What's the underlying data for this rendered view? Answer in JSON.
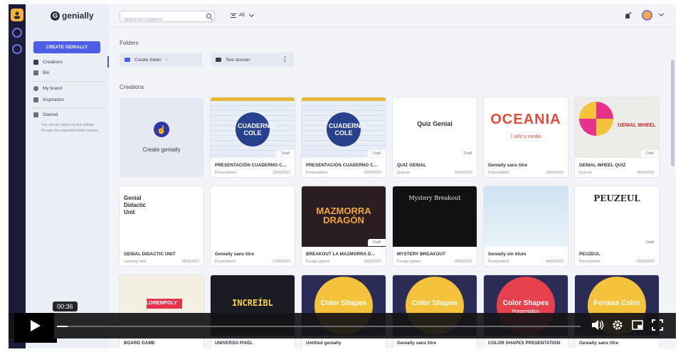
{
  "app": {
    "logo_text": "genially"
  },
  "rail": [
    "avatar-icon",
    "genially-logo-icon",
    "genially-logo-icon"
  ],
  "sidebar": {
    "create_button": "CREATE GENIALLY",
    "items": [
      {
        "label": "Creations",
        "icon": "grid-icon"
      },
      {
        "label": "Bin",
        "icon": "trash-icon"
      },
      {
        "label": "My brand",
        "icon": "brand-icon"
      },
      {
        "label": "Inspiration",
        "icon": "inspiration-icon"
      },
      {
        "label": "Starred",
        "icon": "folder-icon"
      }
    ],
    "starred_note": "You can pin folders to this sidebar through the expanded folder options."
  },
  "topbar": {
    "search_placeholder": "Search for creations",
    "filter_label": "All"
  },
  "folders": {
    "title": "Folders",
    "items": [
      {
        "label": "Create folder"
      },
      {
        "label": "Test dossier"
      }
    ]
  },
  "creations": {
    "title": "Creations",
    "create_label": "Create genially",
    "cards": [
      {
        "title": "PRESENTACIÓN CUADERNO C...",
        "type": "Presentations",
        "date": "19/05/2022",
        "draft": "Draft",
        "thumb_text": "CUADERNO COLE"
      },
      {
        "title": "PRESENTACIÓN CUADERNO C...",
        "type": "Presentations",
        "date": "19/05/2022",
        "draft": "Draft",
        "thumb_text": "CUADERNO COLE"
      },
      {
        "title": "QUIZ GENIAL",
        "type": "Quizzes",
        "date": "19/05/2022",
        "draft": "Draft",
        "thumb_text": "Quiz Genial"
      },
      {
        "title": "Genially sans titre",
        "type": "Personalized",
        "date": "19/05/2022",
        "draft": "",
        "thumb_text": "OCEANIA",
        "thumb_sub": "1 año y medio"
      },
      {
        "title": "GENIAL WHEEL QUIZ",
        "type": "Quizzes",
        "date": "18/05/2022",
        "draft": "Draft",
        "thumb_text": "GENIAL WHEEL"
      },
      {
        "title": "GENIAL DIDACTIC UNIT",
        "type": "Learning units",
        "date": "18/05/2022",
        "draft": "",
        "thumb_text": "Genial Didactic Unit"
      },
      {
        "title": "Genially sans titre",
        "type": "Personalized",
        "date": "17/05/2022",
        "draft": "",
        "thumb_text": ""
      },
      {
        "title": "BREAKOUT LA MAZMORRA D...",
        "type": "Escape games",
        "date": "10/05/2022",
        "draft": "Draft",
        "thumb_text": "MAZMORRA DRAGÓN"
      },
      {
        "title": "MYSTERY BREAKOUT",
        "type": "Escape games",
        "date": "09/05/2022",
        "draft": "",
        "thumb_text": "Mystery Breakout"
      },
      {
        "title": "Genially sin título",
        "type": "Personalized",
        "date": "04/05/2022",
        "draft": "",
        "thumb_text": ""
      },
      {
        "title": "PEUZEUL",
        "type": "Personalized",
        "date": "03/05/2022",
        "draft": "Draft",
        "thumb_text": "PEUZEUL"
      },
      {
        "title": "BOARD GAME",
        "type": "",
        "date": "",
        "draft": "",
        "thumb_text": "LOREMPOLY"
      },
      {
        "title": "UNIVERSO PIXEL",
        "type": "",
        "date": "",
        "draft": "",
        "thumb_text": "INCREÍBL"
      },
      {
        "title": "Untitled genially",
        "type": "",
        "date": "",
        "draft": "",
        "thumb_text": "Color Shapes"
      },
      {
        "title": "Genially sans titre",
        "type": "",
        "date": "",
        "draft": "",
        "thumb_text": "Color Shapes"
      },
      {
        "title": "COLOR SHAPES PRESENTATION",
        "type": "",
        "date": "",
        "draft": "",
        "thumb_text": "Color Shapes",
        "thumb_sub": "Presentation"
      },
      {
        "title": "Genially sans titre",
        "type": "",
        "date": "",
        "draft": "",
        "thumb_text": "Formas Color"
      }
    ]
  },
  "player": {
    "time": "00:36",
    "progress": 0.02
  },
  "colors": {
    "accent": "#4d5ee6",
    "rail": "#1c1c3a"
  }
}
